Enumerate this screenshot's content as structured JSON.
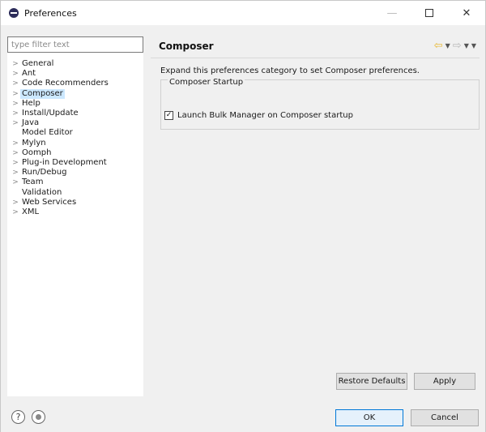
{
  "window": {
    "title": "Preferences",
    "minimize_glyph": "—",
    "maximize_glyph": "",
    "close_glyph": "✕"
  },
  "filter": {
    "placeholder": "type filter text",
    "value": ""
  },
  "tree": {
    "items": [
      {
        "label": "General",
        "expandable": true,
        "selected": false
      },
      {
        "label": "Ant",
        "expandable": true,
        "selected": false
      },
      {
        "label": "Code Recommenders",
        "expandable": true,
        "selected": false
      },
      {
        "label": "Composer",
        "expandable": true,
        "selected": true
      },
      {
        "label": "Help",
        "expandable": true,
        "selected": false
      },
      {
        "label": "Install/Update",
        "expandable": true,
        "selected": false
      },
      {
        "label": "Java",
        "expandable": true,
        "selected": false
      },
      {
        "label": "Model Editor",
        "expandable": false,
        "selected": false
      },
      {
        "label": "Mylyn",
        "expandable": true,
        "selected": false
      },
      {
        "label": "Oomph",
        "expandable": true,
        "selected": false
      },
      {
        "label": "Plug-in Development",
        "expandable": true,
        "selected": false
      },
      {
        "label": "Run/Debug",
        "expandable": true,
        "selected": false
      },
      {
        "label": "Team",
        "expandable": true,
        "selected": false
      },
      {
        "label": "Validation",
        "expandable": false,
        "selected": false
      },
      {
        "label": "Web Services",
        "expandable": true,
        "selected": false
      },
      {
        "label": "XML",
        "expandable": true,
        "selected": false
      }
    ]
  },
  "page": {
    "title": "Composer",
    "description": "Expand this preferences category to set Composer preferences.",
    "group_title": "Composer Startup",
    "checkbox_label": "Launch Bulk Manager on Composer startup",
    "checkbox_checked": true,
    "restore_defaults_label": "Restore Defaults",
    "apply_label": "Apply"
  },
  "nav": {
    "back_glyph": "⇦",
    "forward_glyph": "⇨",
    "dropdown_glyph": "▼"
  },
  "footer": {
    "help_glyph": "?",
    "ok_label": "OK",
    "cancel_label": "Cancel"
  },
  "colors": {
    "selection": "#cce8ff",
    "default_button_border": "#0078d7",
    "back_arrow": "#e8b830"
  },
  "icons": {
    "app": "eclipse-icon",
    "help": "help-icon",
    "tips": "tips-icon"
  }
}
